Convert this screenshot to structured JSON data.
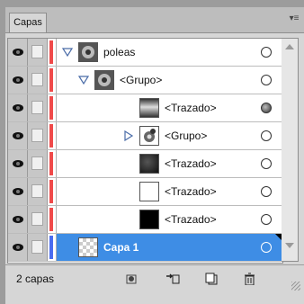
{
  "panel": {
    "tab_label": "Capas",
    "menu_icon": "panel-menu-icon"
  },
  "layers": [
    {
      "name": "poleas",
      "expanded": true,
      "target": "hollow",
      "thumb": "pulley"
    },
    {
      "name": "<Grupo>",
      "expanded": true,
      "target": "hollow",
      "thumb": "pulley"
    },
    {
      "name": "<Trazado>",
      "target": "filled",
      "thumb": "gradient-bar"
    },
    {
      "name": "<Grupo>",
      "expanded": false,
      "target": "hollow",
      "thumb": "pulley"
    },
    {
      "name": "<Trazado>",
      "target": "hollow",
      "thumb": "dark-square"
    },
    {
      "name": "<Trazado>",
      "target": "hollow",
      "thumb": "white-square"
    },
    {
      "name": "<Trazado>",
      "target": "hollow",
      "thumb": "black-square"
    },
    {
      "name": "Capa 1",
      "selected": true,
      "target": "hollow",
      "thumb": "checker"
    }
  ],
  "footer": {
    "count_label": "2 capas"
  },
  "colors": {
    "selection": "#3e8de5",
    "layer_red": "#f04a4a",
    "layer_blue": "#4a6cf0"
  }
}
